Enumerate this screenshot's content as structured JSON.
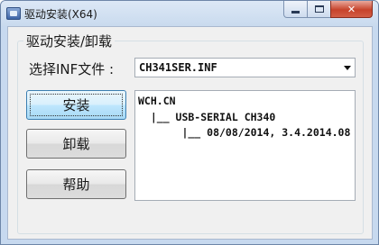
{
  "window": {
    "title": "驱动安装(X64)",
    "controls": {
      "minimize": "minimize",
      "maximize": "maximize",
      "close": "✕"
    }
  },
  "group": {
    "title": "驱动安装/卸载",
    "inf_label": "选择INF文件 :",
    "inf_selected": "CH341SER.INF"
  },
  "buttons": {
    "install": "安装",
    "uninstall": "卸载",
    "help": "帮助"
  },
  "info": {
    "lines": [
      "WCH.CN",
      "  |__ USB-SERIAL CH340",
      "       |__ 08/08/2014, 3.4.2014.08"
    ]
  }
}
